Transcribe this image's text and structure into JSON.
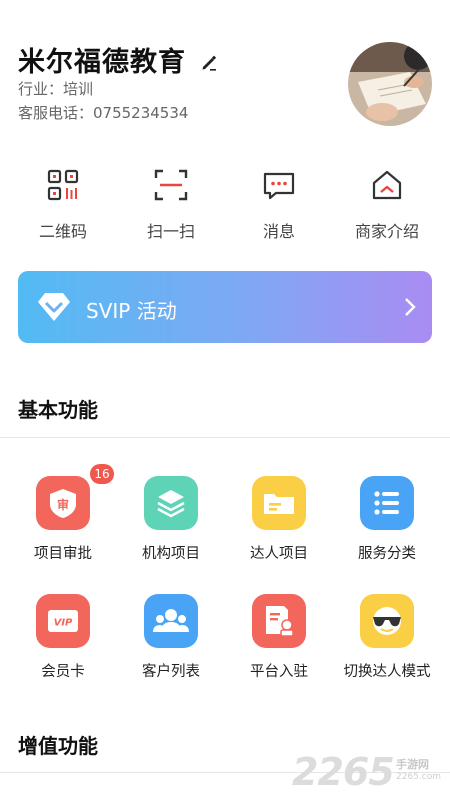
{
  "header": {
    "org_name": "米尔福德教育",
    "industry": "行业：培训",
    "service_phone": "客服电话：0755234534"
  },
  "quick_actions": [
    {
      "label": "二维码",
      "icon": "qrcode-icon"
    },
    {
      "label": "扫一扫",
      "icon": "scan-icon"
    },
    {
      "label": "消息",
      "icon": "message-icon"
    },
    {
      "label": "商家介绍",
      "icon": "store-icon"
    }
  ],
  "svip": {
    "label": "SVIP 活动",
    "icon": "diamond-icon"
  },
  "basic": {
    "title": "基本功能",
    "items": [
      {
        "label": "项目审批",
        "icon": "approval-icon",
        "badge": "16",
        "color": "#f2665c"
      },
      {
        "label": "机构项目",
        "icon": "layers-icon",
        "color": "#5fd3b6"
      },
      {
        "label": "达人项目",
        "icon": "folder-icon",
        "color": "#fbcf45"
      },
      {
        "label": "服务分类",
        "icon": "list-icon",
        "color": "#49a4f5"
      },
      {
        "label": "会员卡",
        "icon": "vip-card-icon",
        "text": "VIP",
        "color": "#f2665c"
      },
      {
        "label": "客户列表",
        "icon": "customers-icon",
        "color": "#49a4f5"
      },
      {
        "label": "平台入驻",
        "icon": "register-icon",
        "color": "#f2665c"
      },
      {
        "label": "切换达人模式",
        "icon": "sunglasses-face-icon",
        "color": "#fbcf45"
      }
    ]
  },
  "value_added": {
    "title": "增值功能"
  },
  "watermark": {
    "number": "2265",
    "text": "手游网",
    "url": "2265.com"
  },
  "colors": {
    "accent_red": "#e8473f",
    "svip_start": "#52bbf3",
    "svip_end": "#a98cf2"
  }
}
